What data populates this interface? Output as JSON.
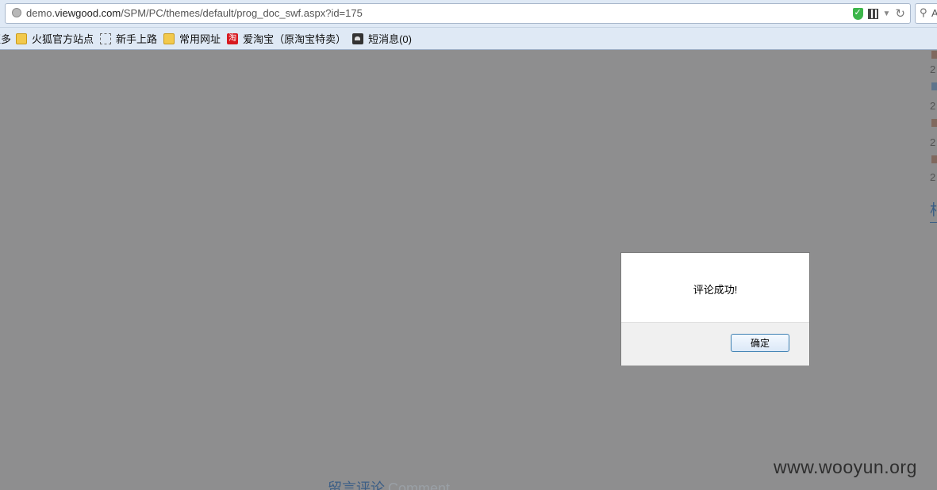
{
  "address_bar": {
    "url_prefix": "demo.",
    "url_domain": "viewgood.com",
    "url_path": "/SPM/PC/themes/default/prog_doc_swf.aspx?id=175",
    "search_placeholder": "A"
  },
  "bookmarks": [
    {
      "label": "火狐官方站点",
      "icon": "folder-icon"
    },
    {
      "label": "新手上路",
      "icon": "dashed-page-icon"
    },
    {
      "label": "常用网址",
      "icon": "folder-icon"
    },
    {
      "label": "爱淘宝（原淘宝特卖）",
      "icon": "taobao-icon"
    },
    {
      "label": "短消息(0)",
      "icon": "message-icon"
    }
  ],
  "bookmarks_overflow_label": "更多",
  "sidebar_fragments": [
    "2",
    "2",
    "2",
    "2"
  ],
  "sidebar_heading_fragment": "相",
  "bottom_heading": {
    "cn": "留言评论",
    "en": "Comment"
  },
  "watermark": "www.wooyun.org",
  "dialog": {
    "message": "评论成功!",
    "ok_label": "确定"
  },
  "colors": {
    "overlay": "#8e8e8f",
    "toolbar": "#dfe9f5",
    "link_blue": "#3b5e86"
  }
}
